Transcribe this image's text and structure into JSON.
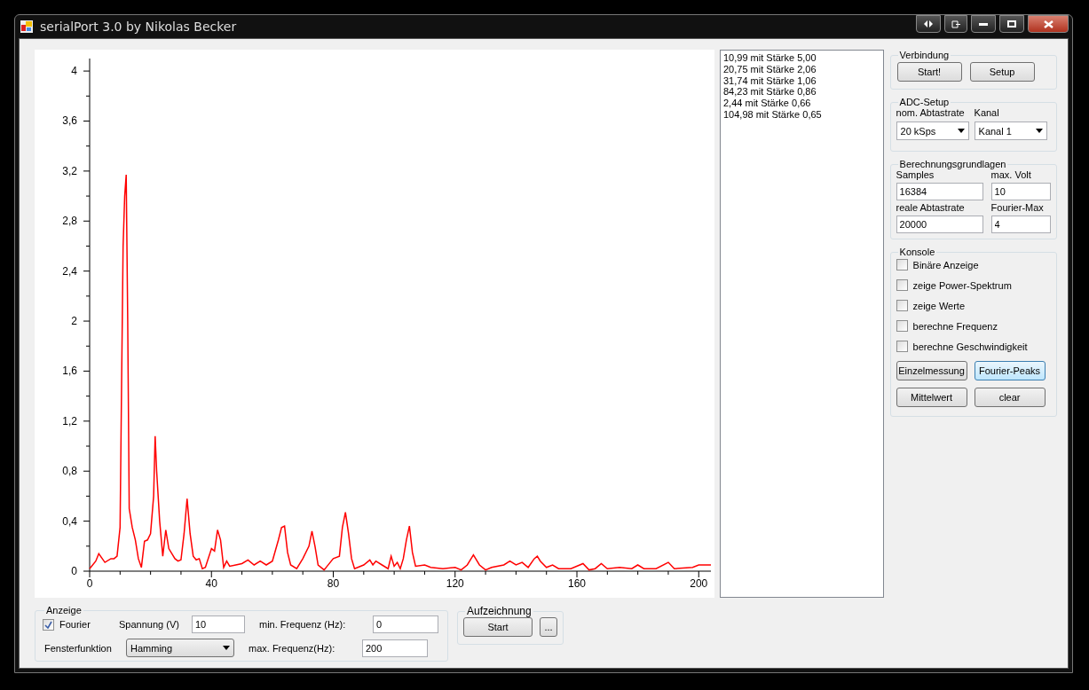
{
  "window": {
    "title": "serialPort 3.0 by Nikolas Becker"
  },
  "chart": {
    "chart_data": {
      "type": "line",
      "xlim": [
        0,
        204
      ],
      "ylim": [
        0,
        4.1
      ],
      "xticks": [
        0,
        40,
        80,
        120,
        160,
        200
      ],
      "yticks": [
        {
          "value": 0,
          "label": "0"
        },
        {
          "value": 0.4,
          "label": "0,4"
        },
        {
          "value": 0.8,
          "label": "0,8"
        },
        {
          "value": 1.2,
          "label": "1,2"
        },
        {
          "value": 1.6,
          "label": "1,6"
        },
        {
          "value": 2,
          "label": "2"
        },
        {
          "value": 2.4,
          "label": "2,4"
        },
        {
          "value": 2.8,
          "label": "2,8"
        },
        {
          "value": 3.2,
          "label": "3,2"
        },
        {
          "value": 3.6,
          "label": "3,6"
        },
        {
          "value": 4,
          "label": "4"
        }
      ],
      "x": [
        0,
        2,
        3,
        5,
        7,
        8,
        9,
        10,
        10.5,
        11,
        11.5,
        12,
        12.5,
        13,
        14,
        15,
        16,
        17,
        18,
        19,
        20,
        21,
        21.5,
        22,
        23,
        24,
        25,
        26,
        28,
        29,
        30,
        31,
        32,
        33,
        34,
        35,
        36,
        37,
        38,
        40,
        41,
        42,
        43,
        44,
        45,
        46,
        48,
        50,
        52,
        54,
        56,
        58,
        60,
        62,
        63,
        64,
        65,
        66,
        68,
        70,
        72,
        73,
        74,
        75,
        77,
        78,
        80,
        82,
        83,
        84,
        85,
        86,
        87,
        90,
        92,
        93,
        94,
        96,
        98,
        99,
        100,
        101,
        102,
        103,
        104,
        105,
        106,
        107,
        110,
        112,
        116,
        120,
        122,
        124,
        126,
        128,
        130,
        132,
        136,
        138,
        140,
        142,
        144,
        146,
        147,
        148,
        150,
        152,
        154,
        158,
        162,
        164,
        166,
        168,
        170,
        174,
        178,
        180,
        182,
        186,
        190,
        192,
        198,
        200,
        204
      ],
      "series": [
        {
          "color": "#ff0000",
          "values": [
            0.02,
            0.08,
            0.14,
            0.07,
            0.1,
            0.1,
            0.12,
            0.35,
            1.5,
            2.6,
            3.0,
            3.17,
            2.0,
            0.5,
            0.35,
            0.25,
            0.1,
            0.03,
            0.24,
            0.25,
            0.3,
            0.6,
            1.08,
            0.8,
            0.4,
            0.12,
            0.33,
            0.18,
            0.1,
            0.08,
            0.09,
            0.3,
            0.58,
            0.3,
            0.12,
            0.09,
            0.1,
            0.02,
            0.03,
            0.18,
            0.16,
            0.33,
            0.25,
            0.03,
            0.08,
            0.04,
            0.05,
            0.06,
            0.09,
            0.05,
            0.08,
            0.05,
            0.08,
            0.25,
            0.35,
            0.36,
            0.15,
            0.05,
            0.02,
            0.1,
            0.2,
            0.32,
            0.2,
            0.05,
            0.01,
            0.04,
            0.1,
            0.12,
            0.35,
            0.47,
            0.3,
            0.1,
            0.02,
            0.05,
            0.09,
            0.05,
            0.08,
            0.05,
            0.02,
            0.12,
            0.04,
            0.07,
            0.02,
            0.1,
            0.25,
            0.36,
            0.15,
            0.04,
            0.05,
            0.03,
            0.02,
            0.03,
            0.01,
            0.05,
            0.13,
            0.05,
            0.01,
            0.03,
            0.05,
            0.08,
            0.05,
            0.07,
            0.03,
            0.1,
            0.12,
            0.08,
            0.03,
            0.05,
            0.02,
            0.02,
            0.06,
            0.01,
            0.02,
            0.06,
            0.02,
            0.03,
            0.02,
            0.05,
            0.02,
            0.02,
            0.07,
            0.02,
            0.03,
            0.05,
            0.05
          ]
        }
      ]
    }
  },
  "peaks_list": [
    "10,99 mit Stärke 5,00",
    "20,75 mit Stärke 2,06",
    "31,74 mit Stärke 1,06",
    "84,23 mit Stärke 0,86",
    "2,44 mit Stärke 0,66",
    "104,98 mit Stärke 0,65"
  ],
  "verbindung": {
    "title": "Verbindung",
    "buttons": [
      "Start!",
      "Setup"
    ]
  },
  "adc_setup": {
    "title": "ADC-Setup",
    "fields": [
      {
        "label": "nom. Abtastrate",
        "value": "20 kSps"
      },
      {
        "label": "Kanal",
        "value": "Kanal 1"
      }
    ]
  },
  "berechnungsgrundlagen": {
    "title": "Berechnungsgrundlagen",
    "fields": [
      {
        "label": "Samples",
        "value": "16384"
      },
      {
        "label": "max. Volt",
        "value": "10"
      },
      {
        "label": "reale Abtastrate",
        "value": "20000"
      },
      {
        "label": "Fourier-Max",
        "value": "4"
      }
    ]
  },
  "konsole": {
    "title": "Konsole",
    "checkboxes": [
      {
        "label": "Binäre Anzeige",
        "checked": false
      },
      {
        "label": "zeige Power-Spektrum",
        "checked": false
      },
      {
        "label": "zeige Werte",
        "checked": false
      },
      {
        "label": "berechne Frequenz",
        "checked": false
      },
      {
        "label": "berechne Geschwindigkeit",
        "checked": false
      }
    ],
    "buttons": [
      {
        "label": "Einzelmessung",
        "selected": false
      },
      {
        "label": "Fourier-Peaks",
        "selected": true
      },
      {
        "label": "Mittelwert",
        "selected": false
      },
      {
        "label": "clear",
        "selected": false
      }
    ]
  },
  "anzeige": {
    "title": "Anzeige",
    "fourier": {
      "label": "Fourier",
      "checked": true
    },
    "spannung": {
      "label": "Spannung (V)",
      "value": "10"
    },
    "fensterfunktion": {
      "label": "Fensterfunktion",
      "value": "Hamming"
    },
    "min_frequenz": {
      "label": "min. Frequenz (Hz):",
      "value": "0"
    },
    "max_frequenz": {
      "label": "max. Frequenz(Hz):",
      "value": "200"
    }
  },
  "aufzeichnung": {
    "title": "Aufzeichnung",
    "buttons": [
      "Start",
      "..."
    ]
  }
}
